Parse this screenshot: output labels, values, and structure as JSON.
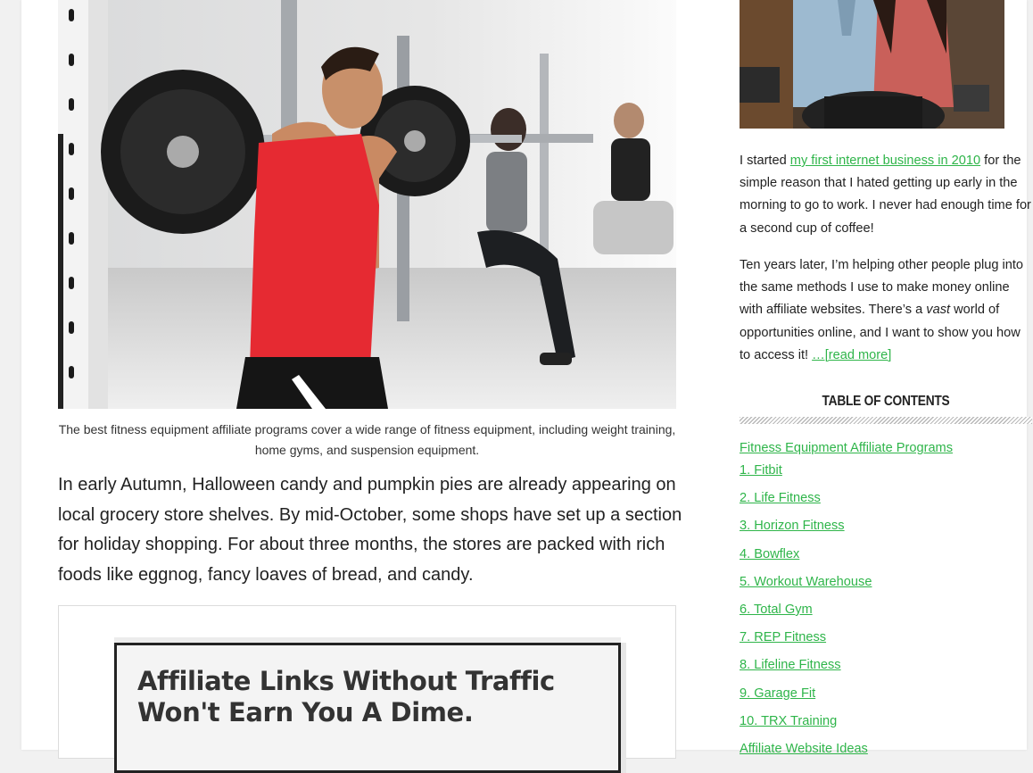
{
  "main": {
    "hero_caption": "The best fitness equipment affiliate programs cover a wide range of fitness equipment, including weight training, home gyms, and suspension equipment.",
    "intro_paragraph": "In early Autumn, Halloween candy and pumpkin pies are already appearing on local grocery store shelves. By mid-October, some shops have set up a section for holiday shopping. For about three months, the stores are packed with rich foods like eggnog, fancy loaves of bread, and candy.",
    "promo_title": "Affiliate Links Without Traffic Won't Earn You A Dime."
  },
  "sidebar": {
    "bio_1_before": "I started ",
    "bio_1_link": "my first internet business in 2010",
    "bio_1_after": " for the simple reason that I hated getting up early in the morning to go to work. I never had enough time for a second cup of coffee!",
    "bio_2_before": "Ten years later, I’m helping other people plug into the same methods I use to make money online with affiliate websites. There’s a ",
    "bio_2_emphasis": "vast",
    "bio_2_after": " world of opportunities online, and I want to show you how to access it! ",
    "read_more": "…[read more]",
    "toc_heading": "TABLE OF CONTENTS",
    "toc_items": [
      "Fitness Equipment Affiliate Programs",
      "1. Fitbit",
      "2. Life Fitness",
      "3. Horizon Fitness",
      "4. Bowflex",
      "5. Workout Warehouse",
      "6. Total Gym",
      "7. REP Fitness",
      "8. Lifeline Fitness",
      "9. Garage Fit",
      "10. TRX Training",
      "Affiliate Website Ideas"
    ]
  },
  "colors": {
    "link": "#2fb54a",
    "text": "#222222",
    "page_bg": "#f1f1f1"
  }
}
